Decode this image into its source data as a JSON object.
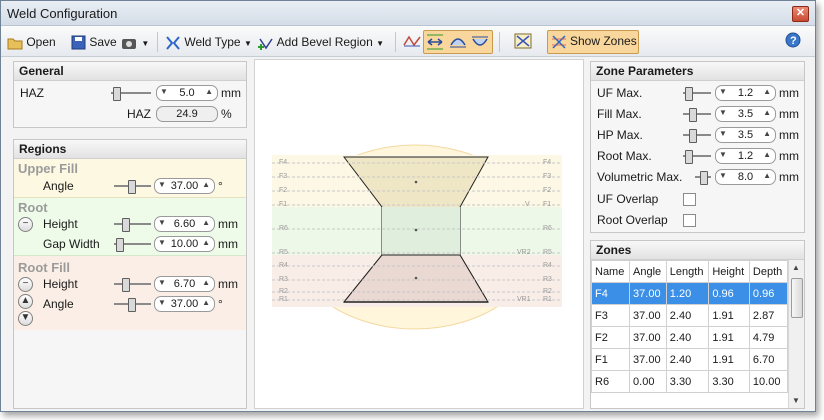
{
  "window": {
    "title": "Weld Configuration"
  },
  "toolbar": {
    "open_label": "Open",
    "save_label": "Save",
    "weld_type_label": "Weld Type",
    "add_bevel_label": "Add Bevel Region",
    "show_zones_label": "Show Zones"
  },
  "general": {
    "header": "General",
    "haz_label": "HAZ",
    "haz_value": "5.0",
    "haz_unit": "mm",
    "haz_pct_label": "HAZ",
    "haz_pct_value": "24.9",
    "haz_pct_unit": "%"
  },
  "regions": {
    "header": "Regions",
    "upper_fill": {
      "title": "Upper Fill",
      "angle_label": "Angle",
      "angle_value": "37.00",
      "angle_unit": "°"
    },
    "root": {
      "title": "Root",
      "height_label": "Height",
      "height_value": "6.60",
      "height_unit": "mm",
      "gap_label": "Gap Width",
      "gap_value": "10.00",
      "gap_unit": "mm"
    },
    "root_fill": {
      "title": "Root Fill",
      "height_label": "Height",
      "height_value": "6.70",
      "height_unit": "mm",
      "angle_label": "Angle",
      "angle_value": "37.00",
      "angle_unit": "°"
    }
  },
  "diagram": {
    "left_labels": [
      "F4",
      "F3",
      "F2",
      "F1",
      "R6",
      "R5",
      "R4",
      "R3",
      "R2",
      "R1"
    ],
    "right_labels": [
      "F4",
      "F3",
      "F2",
      "F1",
      "V",
      "R6",
      "VR2",
      "R5",
      "R4",
      "R3",
      "R2",
      "VR1",
      "R1"
    ]
  },
  "zone_params": {
    "header": "Zone Parameters",
    "uf_max_label": "UF Max.",
    "uf_max_value": "1.2",
    "fill_max_label": "Fill Max.",
    "fill_max_value": "3.5",
    "hp_max_label": "HP Max.",
    "hp_max_value": "3.5",
    "root_max_label": "Root Max.",
    "root_max_value": "1.2",
    "vol_max_label": "Volumetric Max.",
    "vol_max_value": "8.0",
    "unit": "mm",
    "uf_overlap_label": "UF Overlap",
    "root_overlap_label": "Root Overlap"
  },
  "zones": {
    "header": "Zones",
    "columns": [
      "Name",
      "Angle",
      "Length",
      "Height",
      "Depth"
    ],
    "rows": [
      [
        "F4",
        "37.00",
        "1.20",
        "0.96",
        "0.96"
      ],
      [
        "F3",
        "37.00",
        "2.40",
        "1.91",
        "2.87"
      ],
      [
        "F2",
        "37.00",
        "2.40",
        "1.91",
        "4.79"
      ],
      [
        "F1",
        "37.00",
        "2.40",
        "1.91",
        "6.70"
      ],
      [
        "R6",
        "0.00",
        "3.30",
        "3.30",
        "10.00"
      ]
    ],
    "selected_row": 0
  },
  "colors": {
    "upper_fill_bg": "#fdf8e1",
    "root_bg": "#eefbe9",
    "root_fill_bg": "#fbeee6",
    "selected_row": "#3b8fe6",
    "show_zones_active": "#f9d79c"
  }
}
